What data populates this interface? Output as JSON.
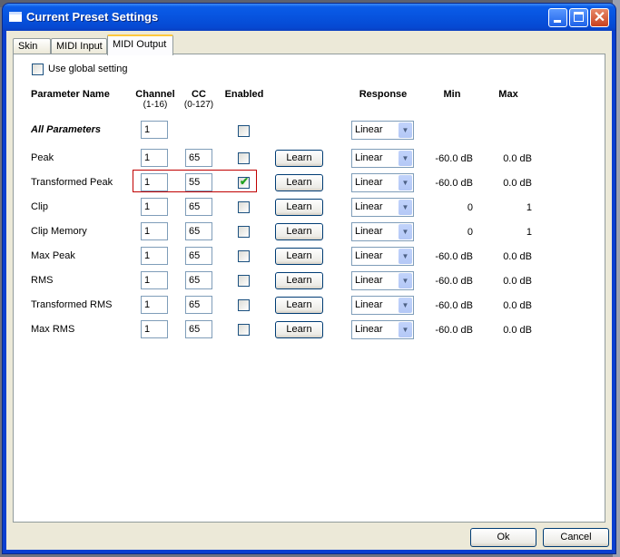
{
  "window": {
    "title": "Current Preset Settings",
    "controls": {
      "minimize": "minimize-icon",
      "maximize": "maximize-icon",
      "close": "close-icon"
    }
  },
  "tabs": [
    {
      "label": "Skin",
      "active": false
    },
    {
      "label": "MIDI Input",
      "active": false
    },
    {
      "label": "MIDI Output",
      "active": true
    }
  ],
  "global_setting": {
    "label": "Use global setting",
    "checked": false
  },
  "headers": {
    "parameter_name": "Parameter Name",
    "channel": "Channel",
    "channel_range": "(1-16)",
    "cc": "CC",
    "cc_range": "(0-127)",
    "enabled": "Enabled",
    "response": "Response",
    "min": "Min",
    "max": "Max"
  },
  "all_parameters": {
    "label": "All Parameters",
    "channel": "1",
    "enabled": false,
    "response": "Linear"
  },
  "learn_label": "Learn",
  "rows": [
    {
      "name": "Peak",
      "channel": "1",
      "cc": "65",
      "enabled": false,
      "response": "Linear",
      "min": "-60.0 dB",
      "max": "0.0 dB"
    },
    {
      "name": "Transformed Peak",
      "channel": "1",
      "cc": "55",
      "enabled": true,
      "response": "Linear",
      "min": "-60.0 dB",
      "max": "0.0 dB",
      "highlighted": true
    },
    {
      "name": "Clip",
      "channel": "1",
      "cc": "65",
      "enabled": false,
      "response": "Linear",
      "min": "0",
      "max": "1"
    },
    {
      "name": "Clip Memory",
      "channel": "1",
      "cc": "65",
      "enabled": false,
      "response": "Linear",
      "min": "0",
      "max": "1"
    },
    {
      "name": "Max Peak",
      "channel": "1",
      "cc": "65",
      "enabled": false,
      "response": "Linear",
      "min": "-60.0 dB",
      "max": "0.0 dB"
    },
    {
      "name": "RMS",
      "channel": "1",
      "cc": "65",
      "enabled": false,
      "response": "Linear",
      "min": "-60.0 dB",
      "max": "0.0 dB"
    },
    {
      "name": "Transformed RMS",
      "channel": "1",
      "cc": "65",
      "enabled": false,
      "response": "Linear",
      "min": "-60.0 dB",
      "max": "0.0 dB"
    },
    {
      "name": "Max RMS",
      "channel": "1",
      "cc": "65",
      "enabled": false,
      "response": "Linear",
      "min": "-60.0 dB",
      "max": "0.0 dB"
    }
  ],
  "buttons": {
    "ok": "Ok",
    "cancel": "Cancel"
  },
  "colors": {
    "titlebar": "#0753de",
    "highlight_border": "#c00000",
    "check": "#21a121"
  }
}
